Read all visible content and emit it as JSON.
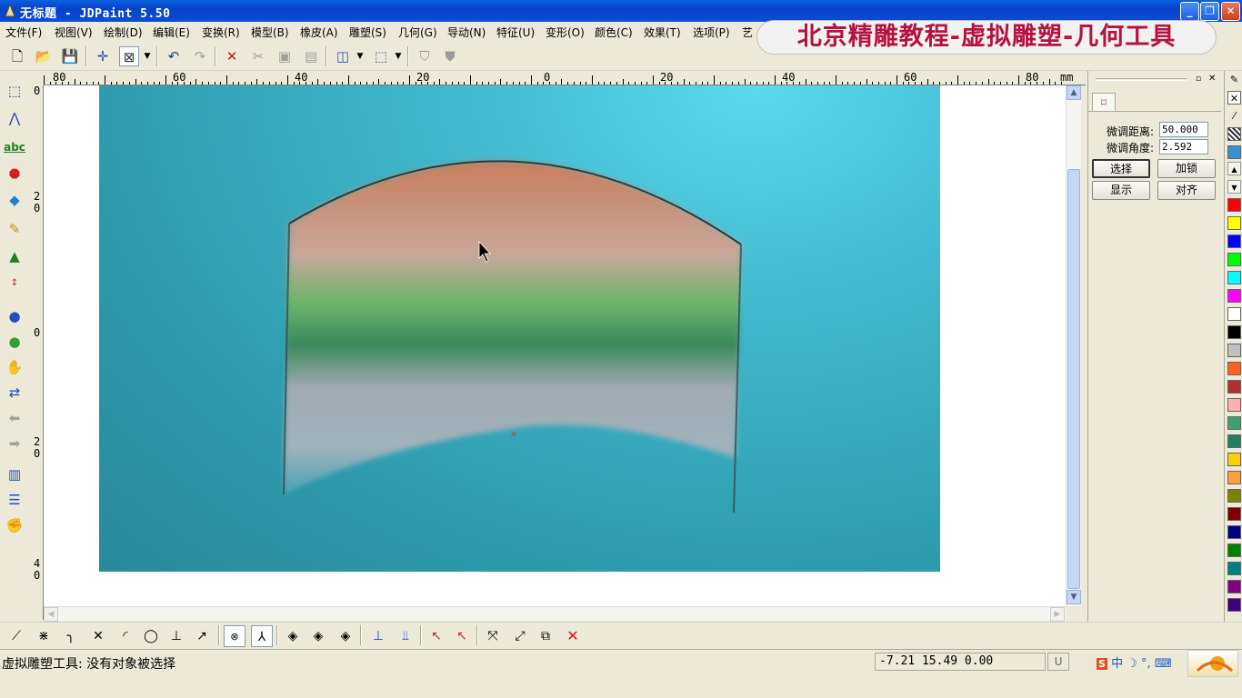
{
  "window": {
    "title": "无标题 - JDPaint 5.50"
  },
  "menu": [
    "文件(F)",
    "视图(V)",
    "绘制(D)",
    "编辑(E)",
    "变换(R)",
    "模型(B)",
    "橡皮(A)",
    "雕塑(S)",
    "几何(G)",
    "导动(N)",
    "特征(U)",
    "变形(O)",
    "颜色(C)",
    "效果(T)",
    "选项(P)",
    "艺"
  ],
  "banner": "北京精雕教程-虚拟雕塑-几何工具",
  "ruler": {
    "unit": "mm",
    "top_labels": [
      "80",
      "60",
      "40",
      "20",
      "0",
      "20",
      "40",
      "60",
      "80"
    ],
    "left_labels": [
      "0",
      "2 0",
      "0",
      "2 0",
      "4 0"
    ]
  },
  "panel": {
    "distance_label": "微调距离:",
    "distance_value": "50.000",
    "angle_label": "微调角度:",
    "angle_value": "2.592",
    "btn_select": "选择",
    "btn_lock": "加锁",
    "btn_show": "显示",
    "btn_align": "对齐"
  },
  "palette": [
    "#ff0000",
    "#ffff00",
    "#0000ff",
    "#00ff00",
    "#00ffff",
    "#ff00ff",
    "#ffffff",
    "#000000",
    "#c0c0c0",
    "#ff6020",
    "#b03030",
    "#ffb0b0",
    "#40a070",
    "#208060",
    "#ffd000",
    "#ffa040",
    "#808000",
    "#800000",
    "#000080",
    "#008000",
    "#008080",
    "#800080",
    "#400080"
  ],
  "status": {
    "message": "虚拟雕塑工具: 没有对象被选择",
    "coords": "-7.21 15.49 0.00",
    "u": "U",
    "ime": "中"
  }
}
